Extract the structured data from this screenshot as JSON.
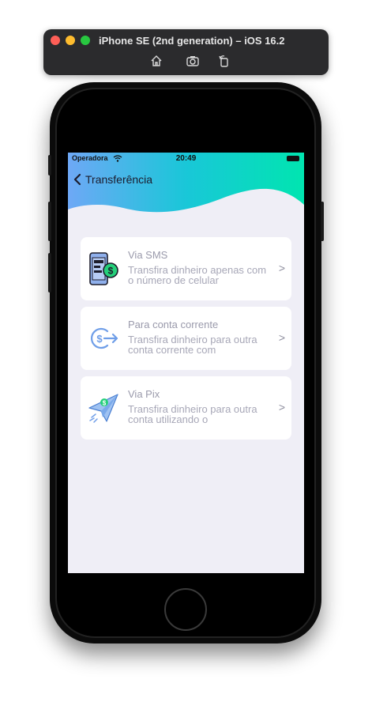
{
  "simulator": {
    "title": "iPhone SE (2nd generation) – iOS 16.2",
    "tools": [
      "home-icon",
      "screenshot-icon",
      "rotate-icon"
    ]
  },
  "status_bar": {
    "carrier": "Operadora",
    "time": "20:49"
  },
  "nav": {
    "back_icon": "chevron-left-icon",
    "title": "Transferência"
  },
  "header_gradient": {
    "from": "#6ea8f6",
    "mid": "#19c7d8",
    "to": "#00e5b0"
  },
  "options": [
    {
      "title": "Via SMS",
      "description": "Transfira dinheiro apenas com o número de celular",
      "icon": "sms-phone-money-icon",
      "chevron": ">"
    },
    {
      "title": "Para conta corrente",
      "description": "Transfira dinheiro para outra conta corrente com",
      "icon": "dollar-transfer-icon",
      "chevron": ">"
    },
    {
      "title": "Via Pix",
      "description": "Transfira dinheiro para outra conta utilizando o",
      "icon": "paper-plane-money-icon",
      "chevron": ">"
    }
  ],
  "colors": {
    "screen_background": "#efeef6",
    "card_background": "#ffffff",
    "text_muted": "#9a9aab"
  }
}
